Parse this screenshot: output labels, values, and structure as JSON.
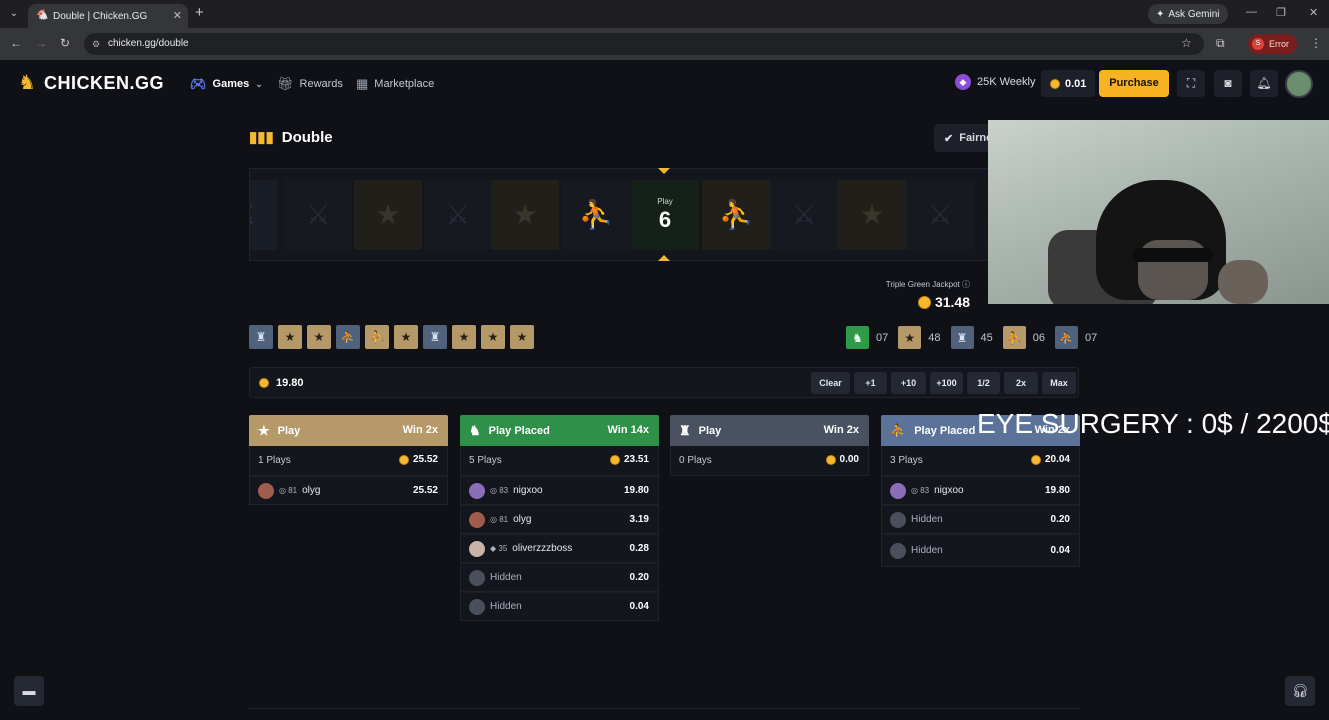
{
  "browser": {
    "tab_title": "Double | Chicken.GG",
    "url": "chicken.gg/double",
    "ask_gemini": "Ask Gemini",
    "error_label": "Error",
    "error_avatar": "S"
  },
  "header": {
    "logo_text": "CHICKEN.GG",
    "nav": [
      "Games",
      "Rewards",
      "Marketplace"
    ],
    "weekly": "25K Weekly",
    "balance": "0.01",
    "purchase": "Purchase"
  },
  "page": {
    "title": "Double",
    "fairness": "Fairness"
  },
  "spinner": {
    "center_label": "Play",
    "center_number": "6"
  },
  "jackpot": {
    "label": "Triple Green Jackpot",
    "value": "31.48"
  },
  "history": [
    "silver",
    "gold",
    "gold",
    "silver",
    "gold",
    "gold",
    "silver",
    "gold",
    "gold",
    "gold"
  ],
  "stats": [
    {
      "color": "green",
      "count": "07"
    },
    {
      "color": "gold",
      "count": "48"
    },
    {
      "color": "silver",
      "count": "45"
    },
    {
      "color": "gold",
      "count": "06"
    },
    {
      "color": "silver",
      "count": "07"
    }
  ],
  "bet": {
    "amount": "19.80",
    "buttons": [
      "Clear",
      "+1",
      "+10",
      "+100",
      "1/2",
      "2x",
      "Max"
    ]
  },
  "columns": [
    {
      "title": "Play",
      "win": "Win 2x",
      "color": "gold",
      "plays": "1 Plays",
      "total": "25.52",
      "rows": [
        {
          "level": "81",
          "name": "olyg",
          "amount": "25.52",
          "hidden": false
        }
      ]
    },
    {
      "title": "Play Placed",
      "win": "Win 14x",
      "color": "green",
      "plays": "5 Plays",
      "total": "23.51",
      "rows": [
        {
          "level": "83",
          "name": "nigxoo",
          "amount": "19.80",
          "hidden": false
        },
        {
          "level": "81",
          "name": "olyg",
          "amount": "3.19",
          "hidden": false
        },
        {
          "level": "35",
          "name": "oliverzzzboss",
          "amount": "0.28",
          "hidden": false
        },
        {
          "level": "",
          "name": "Hidden",
          "amount": "0.20",
          "hidden": true
        },
        {
          "level": "",
          "name": "Hidden",
          "amount": "0.04",
          "hidden": true
        }
      ]
    },
    {
      "title": "Play",
      "win": "Win 2x",
      "color": "silver",
      "plays": "0 Plays",
      "total": "0.00",
      "rows": []
    },
    {
      "title": "Play Placed",
      "win": "Win 2x",
      "color": "blue",
      "plays": "3 Plays",
      "total": "20.04",
      "rows": [
        {
          "level": "83",
          "name": "nigxoo",
          "amount": "19.80",
          "hidden": false
        },
        {
          "level": "",
          "name": "Hidden",
          "amount": "0.20",
          "hidden": true
        },
        {
          "level": "",
          "name": "Hidden",
          "amount": "0.04",
          "hidden": true
        }
      ]
    }
  ],
  "overlay": {
    "text": "EYE SURGERY : 0$ / 2200$"
  }
}
